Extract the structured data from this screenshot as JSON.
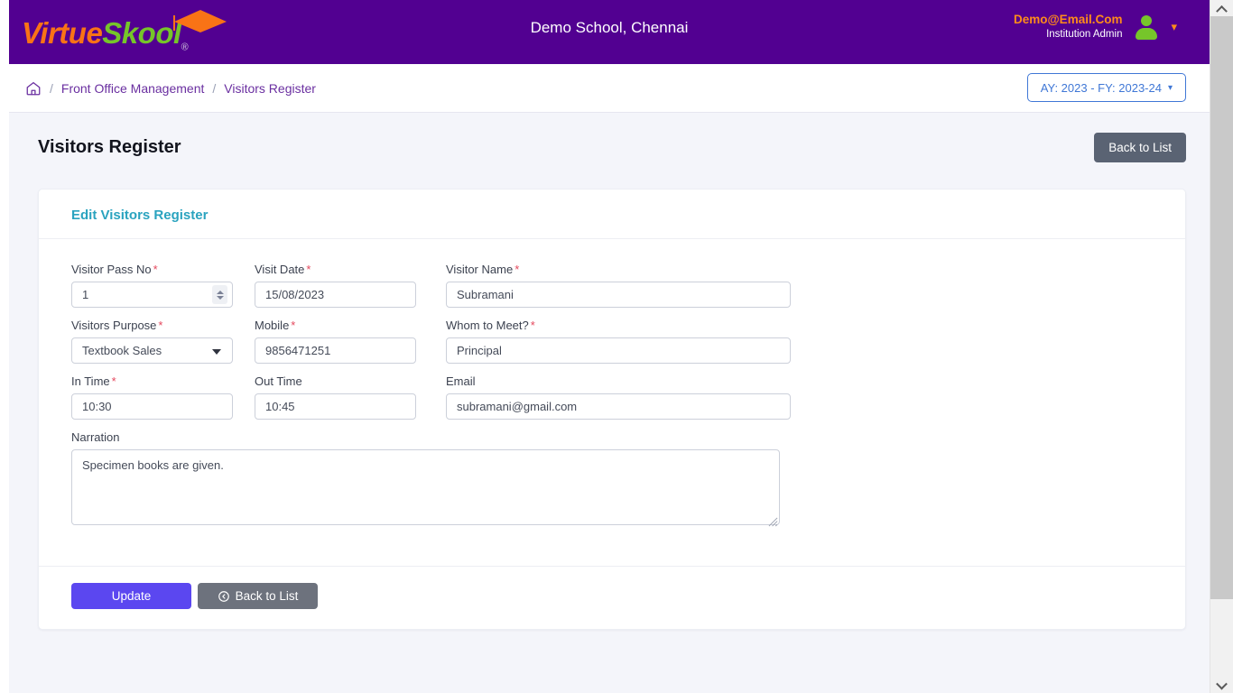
{
  "header": {
    "brand": {
      "part1": "Virtue",
      "part2": "Skool",
      "registered": "®",
      "cap_icon": "graduation-cap-icon"
    },
    "school_name": "Demo School, Chennai",
    "user_email": "Demo@Email.Com",
    "user_role": "Institution Admin",
    "avatar_icon": "user-avatar-icon",
    "caret_icon": "chevron-down-icon"
  },
  "breadcrumb": {
    "home_icon": "home-icon",
    "separator": "/",
    "items": [
      {
        "label": "Front Office Management"
      },
      {
        "label": "Visitors Register"
      }
    ],
    "ayfy_label": "AY: 2023 - FY: 2023-24",
    "ayfy_caret": "chevron-down-icon"
  },
  "page": {
    "title": "Visitors Register",
    "back_to_list_top": "Back to List"
  },
  "card": {
    "title": "Edit Visitors Register",
    "fields": {
      "visitor_pass_no": {
        "label": "Visitor Pass No",
        "required": true,
        "value": "1"
      },
      "visit_date": {
        "label": "Visit Date",
        "required": true,
        "value": "15/08/2023"
      },
      "visitor_name": {
        "label": "Visitor Name",
        "required": true,
        "value": "Subramani"
      },
      "visitors_purpose": {
        "label": "Visitors Purpose",
        "required": true,
        "value": "Textbook Sales"
      },
      "mobile": {
        "label": "Mobile",
        "required": true,
        "value": "9856471251"
      },
      "whom_to_meet": {
        "label": "Whom to Meet?",
        "required": true,
        "value": "Principal"
      },
      "in_time": {
        "label": "In Time",
        "required": true,
        "value": "10:30"
      },
      "out_time": {
        "label": "Out Time",
        "required": false,
        "value": "10:45"
      },
      "email": {
        "label": "Email",
        "required": false,
        "value": "subramani@gmail.com"
      },
      "narration": {
        "label": "Narration",
        "required": false,
        "value": "Specimen books are given."
      }
    },
    "required_marker": "*",
    "footer": {
      "update_label": "Update",
      "back_label": "Back to List",
      "back_icon": "arrow-circle-left-icon"
    }
  },
  "colors": {
    "header_purple": "#520091",
    "brand_orange": "#f97316",
    "brand_green": "#76c52a",
    "breadcrumb_purple": "#6a2fa0",
    "ayfy_blue": "#3f77d6",
    "card_title_teal": "#2aa3bf",
    "update_purple": "#5b47f0",
    "gray_button": "#6d727d",
    "required_red": "#e4485d",
    "page_bg": "#f4f5fa"
  },
  "scrollbar": {
    "up_icon": "chevron-up-icon",
    "down_icon": "chevron-down-icon"
  }
}
